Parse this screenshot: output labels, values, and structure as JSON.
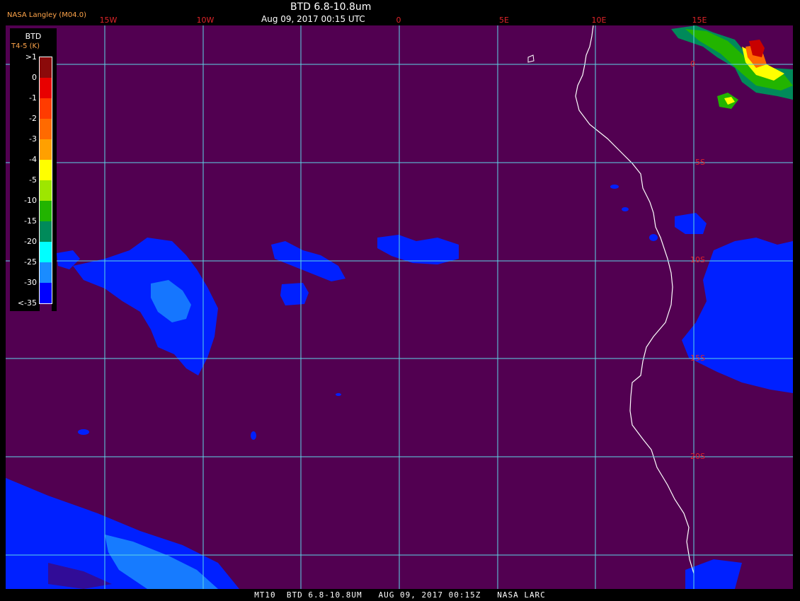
{
  "header": {
    "credit": "NASA Langley (M04.0)",
    "title": "BTD 6.8-10.8um",
    "subtitle": "Aug 09, 2017 00:15 UTC"
  },
  "footer": {
    "text": "MT10  BTD 6.8-10.8UM   AUG 09, 2017 00:15Z   NASA LARC"
  },
  "map": {
    "background_color": "#520051",
    "grid_color": "#5ed7e6",
    "label_color": "#e0242a",
    "coastline_color": "#ffffff",
    "longitude_labels": [
      "15W",
      "10W",
      "0",
      "5E",
      "10E",
      "15E"
    ],
    "latitude_labels": [
      "0",
      "5S",
      "10S",
      "15S",
      "20S"
    ]
  },
  "legend": {
    "title": "BTD",
    "unit": "T4-5 (K)",
    "entries": [
      {
        "label": ">1",
        "color": "#8b0a0a"
      },
      {
        "label": "0",
        "color": "#e80000"
      },
      {
        "label": "-1",
        "color": "#ff3b00"
      },
      {
        "label": "-2",
        "color": "#ff6a00"
      },
      {
        "label": "-3",
        "color": "#ffa000"
      },
      {
        "label": "-4",
        "color": "#ffff00"
      },
      {
        "label": "-5",
        "color": "#9ee600"
      },
      {
        "label": "-10",
        "color": "#22b400"
      },
      {
        "label": "-15",
        "color": "#008a5a"
      },
      {
        "label": "-20",
        "color": "#00ffff"
      },
      {
        "label": "-25",
        "color": "#1a8cff"
      },
      {
        "label": "-30",
        "color": "#0000ff"
      },
      {
        "label": "<-35",
        "color": "#520051"
      }
    ]
  }
}
